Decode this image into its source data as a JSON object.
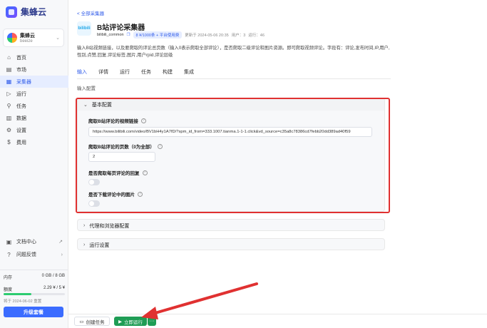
{
  "brand": {
    "name": "集蜂云"
  },
  "account": {
    "name": "集蜂云",
    "sub": "beeize"
  },
  "nav": [
    {
      "label": "首页",
      "icon": "home-icon"
    },
    {
      "label": "市场",
      "icon": "market-icon"
    },
    {
      "label": "采集器",
      "icon": "collector-icon",
      "active": true
    },
    {
      "label": "运行",
      "icon": "run-icon"
    },
    {
      "label": "任务",
      "icon": "task-icon"
    },
    {
      "label": "数据",
      "icon": "data-icon"
    },
    {
      "label": "设置",
      "icon": "gear-icon"
    },
    {
      "label": "费用",
      "icon": "billing-icon"
    }
  ],
  "sidebar_bottom": {
    "docs": "文档中心",
    "feedback": "问题反馈",
    "memory_label": "内存",
    "memory_value": "0 GB / 8 GB",
    "quota_label": "额度",
    "quota_value": "2.29 ¥ / 5 ¥",
    "quota_fraction": 0.458,
    "reset": "将于 2024-06-02 重置",
    "upgrade": "升级套餐"
  },
  "header": {
    "back": "< 全部采集器",
    "app_icon_text": "bilibili",
    "title": "B站评论采集器",
    "author": "bilibili_common",
    "price": "8 ¥/1000条 + 平台使用费",
    "updated": "更新于 2024-05-06 20:35",
    "users": "用户：3",
    "runs": "运行：46",
    "description": "输入B站视频链接，以及要爬取的评论总页数（输入0表示爬取全部评论），是否爬取二级评论和图片资源。即可爬取视频评论。字段有：评论,发布时间,IP,用户,性别,点赞,回复,评论标签,图片,用户rpid,评论层级"
  },
  "tabs": [
    "输入",
    "详情",
    "运行",
    "任务",
    "构建",
    "集成"
  ],
  "input_section_label": "输入配置",
  "basic": {
    "title": "基本配置",
    "video_url_label": "爬取B站评论的视频链接",
    "video_url_value": "https://www.bilibili.com/video/BV1bH4y1A7fD/?spm_id_from=333.1007.tianma.1-1-1.click&vd_source=c35a8c78386cd7febb20dd389ad40f59",
    "pages_label": "爬取B站评论的页数（0为全部）",
    "pages_value": "2",
    "replies_label": "是否爬取每页评论的回复",
    "images_label": "是否下载评论中的图片"
  },
  "proxy": {
    "title": "代理和浏览器配置"
  },
  "run_settings": {
    "title": "运行设置"
  },
  "footer": {
    "create_task": "创建任务",
    "run_now": "立即运行",
    "more": "···"
  },
  "colors": {
    "accent": "#2f5bea",
    "highlight": "#e03131",
    "run": "#1f9d55"
  }
}
